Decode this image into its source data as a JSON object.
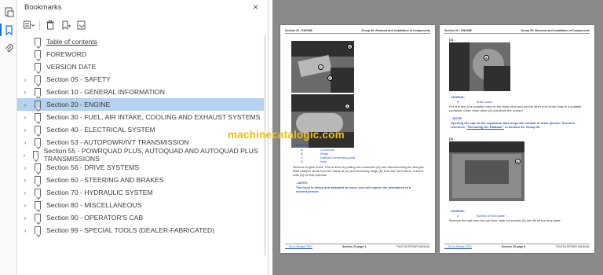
{
  "rail": {
    "icons": [
      "page-thumbnails-icon",
      "bookmark-icon",
      "attachment-icon"
    ]
  },
  "bookmarks": {
    "title": "Bookmarks",
    "close": "×",
    "items": [
      {
        "label": "Table of contents",
        "expandable": false,
        "selected": false
      },
      {
        "label": "FOREWORD",
        "expandable": false,
        "selected": false
      },
      {
        "label": "VERSION DATE",
        "expandable": false,
        "selected": false
      },
      {
        "label": "Section 05 - SAFETY",
        "expandable": true,
        "selected": false
      },
      {
        "label": "Section 10 - GENERAL INFORMATION",
        "expandable": true,
        "selected": false
      },
      {
        "label": "Section 20 - ENGINE",
        "expandable": true,
        "selected": true
      },
      {
        "label": "Section 30 - FUEL, AIR INTAKE, COOLING AND EXHAUST SYSTEMS",
        "expandable": true,
        "selected": false
      },
      {
        "label": "Section 40 - ELECTRICAL SYSTEM",
        "expandable": true,
        "selected": false
      },
      {
        "label": "Section 53 - AUTOPOWR/IVT TRANSMISSION",
        "expandable": true,
        "selected": false
      },
      {
        "label": "Section 55 - POWRQUAD PLUS, AUTOQUAD AND AUTOQUAD PLUS TRANSMISSIONS",
        "expandable": true,
        "selected": false
      },
      {
        "label": "Section 56 - DRIVE SYSTEMS",
        "expandable": true,
        "selected": false
      },
      {
        "label": "Section 60 - STEERING AND BRAKES",
        "expandable": true,
        "selected": false
      },
      {
        "label": "Section 70 - HYDRAULIC SYSTEM",
        "expandable": true,
        "selected": false
      },
      {
        "label": "Section 80 - MISCELLANEOUS",
        "expandable": true,
        "selected": false
      },
      {
        "label": "Section 90 - OPERATOR'S CAB",
        "expandable": true,
        "selected": false
      },
      {
        "label": "Section 99 - SPECIAL TOOLS (DEALER-FABRICATED)",
        "expandable": true,
        "selected": false
      }
    ]
  },
  "watermark": "machinecatalogic.com",
  "page_left": {
    "header_left": "Section 20 - ENGINE",
    "header_right": "Group 00: Removal and Installation of Components",
    "legend_title": "LEGEND:",
    "legend": [
      {
        "key": "A",
        "text": "Connector"
      },
      {
        "key": "B",
        "text": "Hinge"
      },
      {
        "key": "C",
        "text": "Damper connecting point"
      },
      {
        "key": "D",
        "text": "Nuts"
      }
    ],
    "body": "Remove engine hood. This is done by pulling out connector (A) and disconnecting the two gas-filled damper struts from the frame at (C) and removing hinge (B) from the front frame, remove nuts (D) for this purpose.",
    "note_title": "--NOTE:",
    "note": "The hood is heavy and awkward to move; you will require the assistance of a second person.",
    "footer_left": "← Go to Section TOC",
    "footer_center": "Section 20 page 3",
    "footer_right": "TM4716-REPAIR MANUAL"
  },
  "page_right": {
    "header_left": "Section 20 - ENGINE",
    "header_right": "Group 00: Removal and Installation of Components",
    "step1": "[3] -",
    "legend1_title": "LEGEND:",
    "legend1": [
      {
        "key": "A",
        "text": "Drain valve"
      }
    ],
    "body1": "Put one end of a suitable hose on the drain neck and put the other end of the hose in a suitable container. Open drain valve (A) and drain the coolant.",
    "note_title": "--NOTE:",
    "note1": "Opening the cap on the expansion tank helps the coolant to drain quicker.",
    "see_ref_prefix": "See also reference,",
    "see_ref_link": "\"Removing the Radiator\"",
    "see_ref_suffix": "in Section 30, Group 20.",
    "step2": "[4] -",
    "legend2_title": "LEGEND:",
    "legend2": [
      {
        "key": "A",
        "text": "Screws in floor-plate"
      }
    ],
    "body2": "Remove the mat from the cab floor, take out screws (A) and lift off the floor-plate.",
    "footer_left": "← Go to Section TOC",
    "footer_center": "Section 20 page 4",
    "footer_right": "TM4716-REPAIR MANUAL"
  }
}
